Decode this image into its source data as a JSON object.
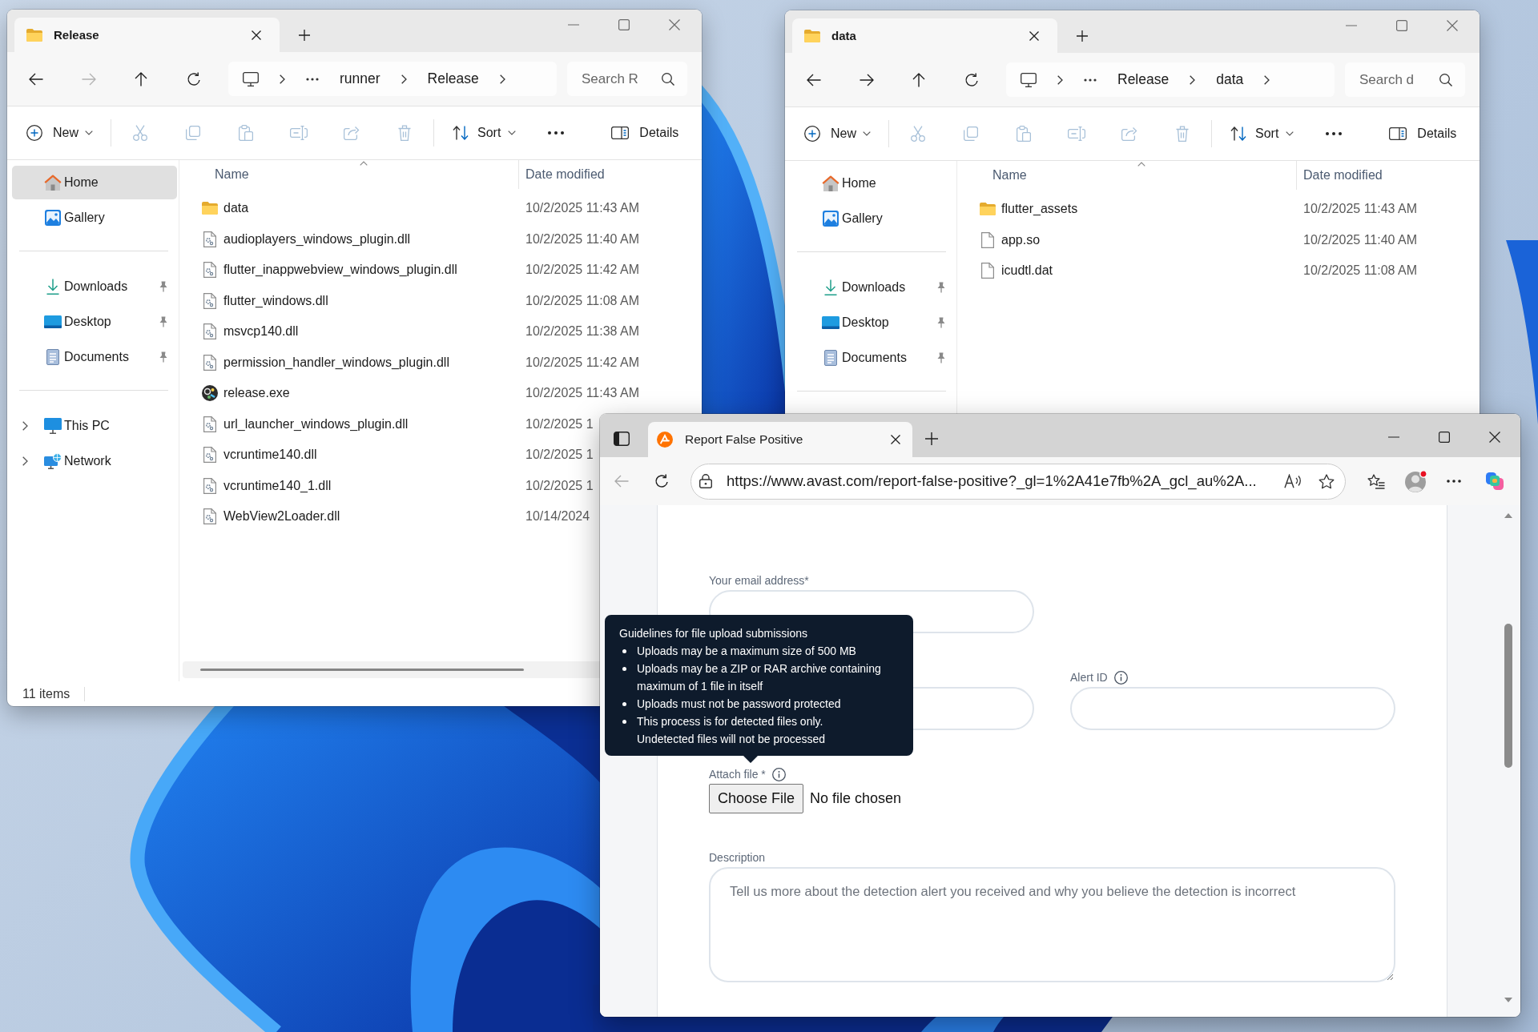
{
  "explorers": [
    {
      "tab": {
        "title": "Release"
      },
      "nav": {
        "forward_disabled": true
      },
      "breadcrumb": [
        "runner",
        "Release"
      ],
      "search": {
        "placeholder": "Search R"
      },
      "toolbar": {
        "new": "New",
        "edit_disabled": true,
        "sort": "Sort",
        "details": "Details"
      },
      "sidebar": {
        "groups": [
          {
            "items": [
              {
                "label": "Home",
                "kind": "home",
                "selected": true,
                "pinned": false
              },
              {
                "label": "Gallery",
                "kind": "gallery",
                "selected": false,
                "pinned": false
              }
            ]
          },
          {
            "items": [
              {
                "label": "Downloads",
                "kind": "downloads",
                "selected": false,
                "pinned": true
              },
              {
                "label": "Desktop",
                "kind": "desktop",
                "selected": false,
                "pinned": true
              },
              {
                "label": "Documents",
                "kind": "documents",
                "selected": false,
                "pinned": true
              }
            ]
          },
          {
            "items": [
              {
                "label": "This PC",
                "kind": "pc",
                "selected": false,
                "pinned": false,
                "expanded": false
              },
              {
                "label": "Network",
                "kind": "network",
                "selected": false,
                "pinned": false,
                "expanded": false
              }
            ]
          }
        ]
      },
      "columns": [
        {
          "label": "Name",
          "sorted_ascending": true
        },
        {
          "label": "Date modified"
        }
      ],
      "files": [
        {
          "name": "data",
          "kind": "folder",
          "date": "10/2/2025 11:43 AM"
        },
        {
          "name": "audioplayers_windows_plugin.dll",
          "kind": "dll",
          "date": "10/2/2025 11:40 AM"
        },
        {
          "name": "flutter_inappwebview_windows_plugin.dll",
          "kind": "dll",
          "date": "10/2/2025 11:42 AM"
        },
        {
          "name": "flutter_windows.dll",
          "kind": "dll",
          "date": "10/2/2025 11:08 AM"
        },
        {
          "name": "msvcp140.dll",
          "kind": "dll",
          "date": "10/2/2025 11:38 AM"
        },
        {
          "name": "permission_handler_windows_plugin.dll",
          "kind": "dll",
          "date": "10/2/2025 11:42 AM"
        },
        {
          "name": "release.exe",
          "kind": "exe",
          "date": "10/2/2025 11:43 AM"
        },
        {
          "name": "url_launcher_windows_plugin.dll",
          "kind": "dll",
          "date": "10/2/2025 1"
        },
        {
          "name": "vcruntime140.dll",
          "kind": "dll",
          "date": "10/2/2025 1"
        },
        {
          "name": "vcruntime140_1.dll",
          "kind": "dll",
          "date": "10/2/2025 1"
        },
        {
          "name": "WebView2Loader.dll",
          "kind": "dll",
          "date": "10/14/2024"
        }
      ],
      "status_bar": {
        "item_count": "11 items"
      }
    },
    {
      "tab": {
        "title": "data"
      },
      "nav": {
        "forward_disabled": false
      },
      "breadcrumb": [
        "Release",
        "data"
      ],
      "search": {
        "placeholder": "Search d"
      },
      "toolbar": {
        "new": "New",
        "edit_disabled": true,
        "sort": "Sort",
        "details": "Details"
      },
      "sidebar": {
        "groups": [
          {
            "items": [
              {
                "label": "Home",
                "kind": "home",
                "selected": false,
                "pinned": false
              },
              {
                "label": "Gallery",
                "kind": "gallery",
                "selected": false,
                "pinned": false
              }
            ]
          },
          {
            "items": [
              {
                "label": "Downloads",
                "kind": "downloads",
                "selected": false,
                "pinned": true
              },
              {
                "label": "Desktop",
                "kind": "desktop",
                "selected": false,
                "pinned": true
              },
              {
                "label": "Documents",
                "kind": "documents",
                "selected": false,
                "pinned": true
              }
            ]
          }
        ]
      },
      "columns": [
        {
          "label": "Name",
          "sorted_ascending": true
        },
        {
          "label": "Date modified"
        }
      ],
      "files": [
        {
          "name": "flutter_assets",
          "kind": "folder",
          "date": "10/2/2025 11:43 AM"
        },
        {
          "name": "app.so",
          "kind": "file",
          "date": "10/2/2025 11:40 AM"
        },
        {
          "name": "icudtl.dat",
          "kind": "file",
          "date": "10/2/2025 11:08 AM"
        }
      ]
    }
  ],
  "browser": {
    "tab": {
      "title": "Report False Positive"
    },
    "nav": {
      "back_disabled": true
    },
    "url": "https://www.avast.com/report-false-positive?_gl=1%2A41e7fb%2A_gcl_au%2A...",
    "profile": {
      "notification": true
    },
    "form": {
      "rows": [
        {
          "fields": [
            {
              "kind": "input",
              "label": "Your email address*"
            }
          ]
        },
        {
          "fields": [
            {
              "kind": "input"
            },
            {
              "kind": "input",
              "label": "Alert ID",
              "info": true
            }
          ]
        },
        {
          "fields": [
            {
              "kind": "file",
              "label": "Attach file *",
              "info": true,
              "button": "Choose File",
              "status": "No file chosen"
            }
          ]
        },
        {
          "fields": [
            {
              "kind": "textarea",
              "label": "Description",
              "placeholder": "Tell us more about the detection alert you received and why you believe the detection is incorrect"
            }
          ]
        }
      ]
    },
    "tooltip": {
      "title": "Guidelines for file upload submissions",
      "items": [
        {
          "lines": [
            "Uploads may be a maximum size of 500 MB"
          ]
        },
        {
          "lines": [
            "Uploads may be a ZIP or RAR archive containing",
            "maximum of 1 file in itself"
          ]
        },
        {
          "lines": [
            "Uploads must not be password protected"
          ]
        },
        {
          "lines": [
            "This process is for detected files only.",
            "Undetected files will not be processed"
          ]
        }
      ]
    }
  }
}
